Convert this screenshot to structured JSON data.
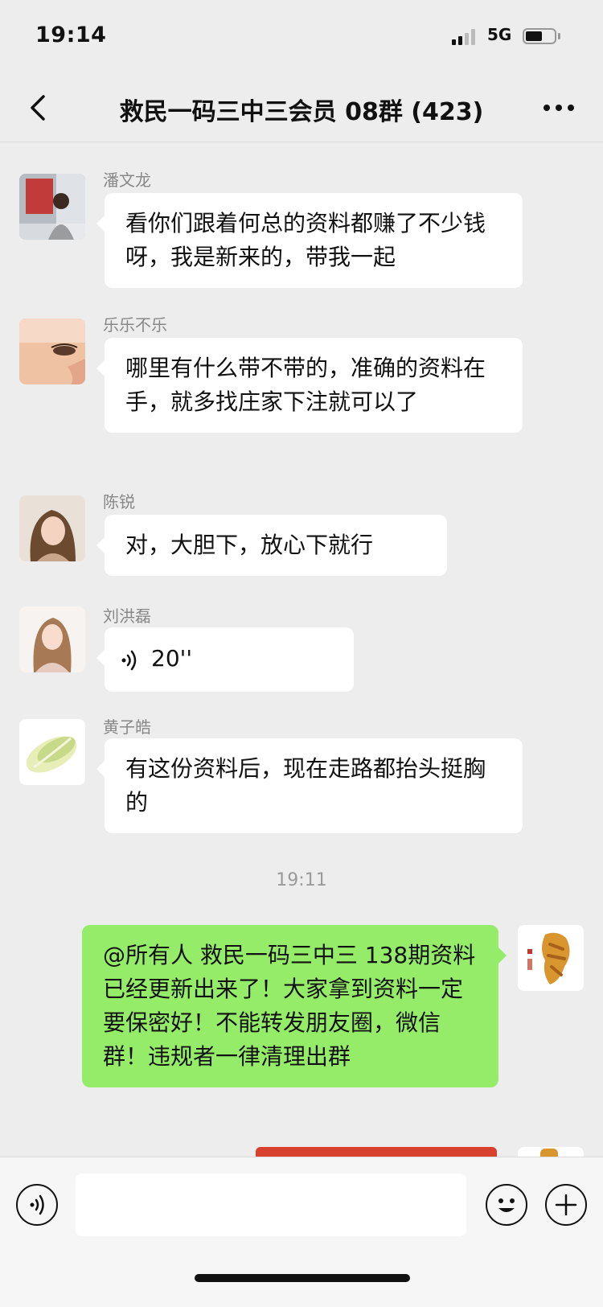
{
  "status_bar": {
    "time": "19:14",
    "network": "5G",
    "battery_fraction": 0.6
  },
  "nav": {
    "title": "救民一码三中三会员 08群 (423)"
  },
  "messages": [
    {
      "sender": "潘文龙",
      "text": "看你们跟着何总的资料都赚了不少钱呀，我是新来的，带我一起"
    },
    {
      "sender": "乐乐不乐",
      "text": "哪里有什么带不带的，准确的资料在手，就多找庄家下注就可以了"
    },
    {
      "sender": "陈锐",
      "text": "对，大胆下，放心下就行"
    },
    {
      "sender": "刘洪磊",
      "voice_duration": "20''"
    },
    {
      "sender": "黄子皓",
      "text": "有这份资料后，现在走路都抬头挺胸的"
    }
  ],
  "timestamp": "19:11",
  "own_message": {
    "text": "@所有人  救民一码三中三 138期资料已经更新出来了！大家拿到资料一定要保密好！不能转发朋友圈，微信群！违规者一律清理出群"
  },
  "input": {
    "value": ""
  },
  "colors": {
    "background": "#ededed",
    "own_bubble": "#95ec69",
    "other_bubble": "#ffffff"
  }
}
